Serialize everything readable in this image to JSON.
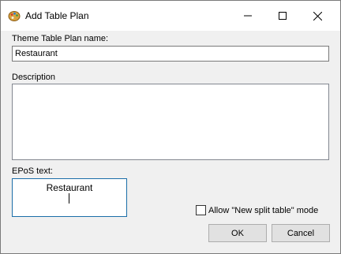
{
  "window": {
    "title": "Add Table Plan",
    "icon": "palette-icon",
    "controls": {
      "minimize": "minimize-icon",
      "maximize": "maximize-icon",
      "close": "close-icon"
    }
  },
  "form": {
    "name_label": "Theme Table Plan name:",
    "name_value": "Restaurant",
    "description_label": "Description",
    "description_value": "",
    "epos_label": "EPoS text:",
    "epos_value": "Restaurant",
    "split_checkbox_label": "Allow \"New split table\" mode",
    "split_checked": false
  },
  "buttons": {
    "ok": "OK",
    "cancel": "Cancel"
  }
}
